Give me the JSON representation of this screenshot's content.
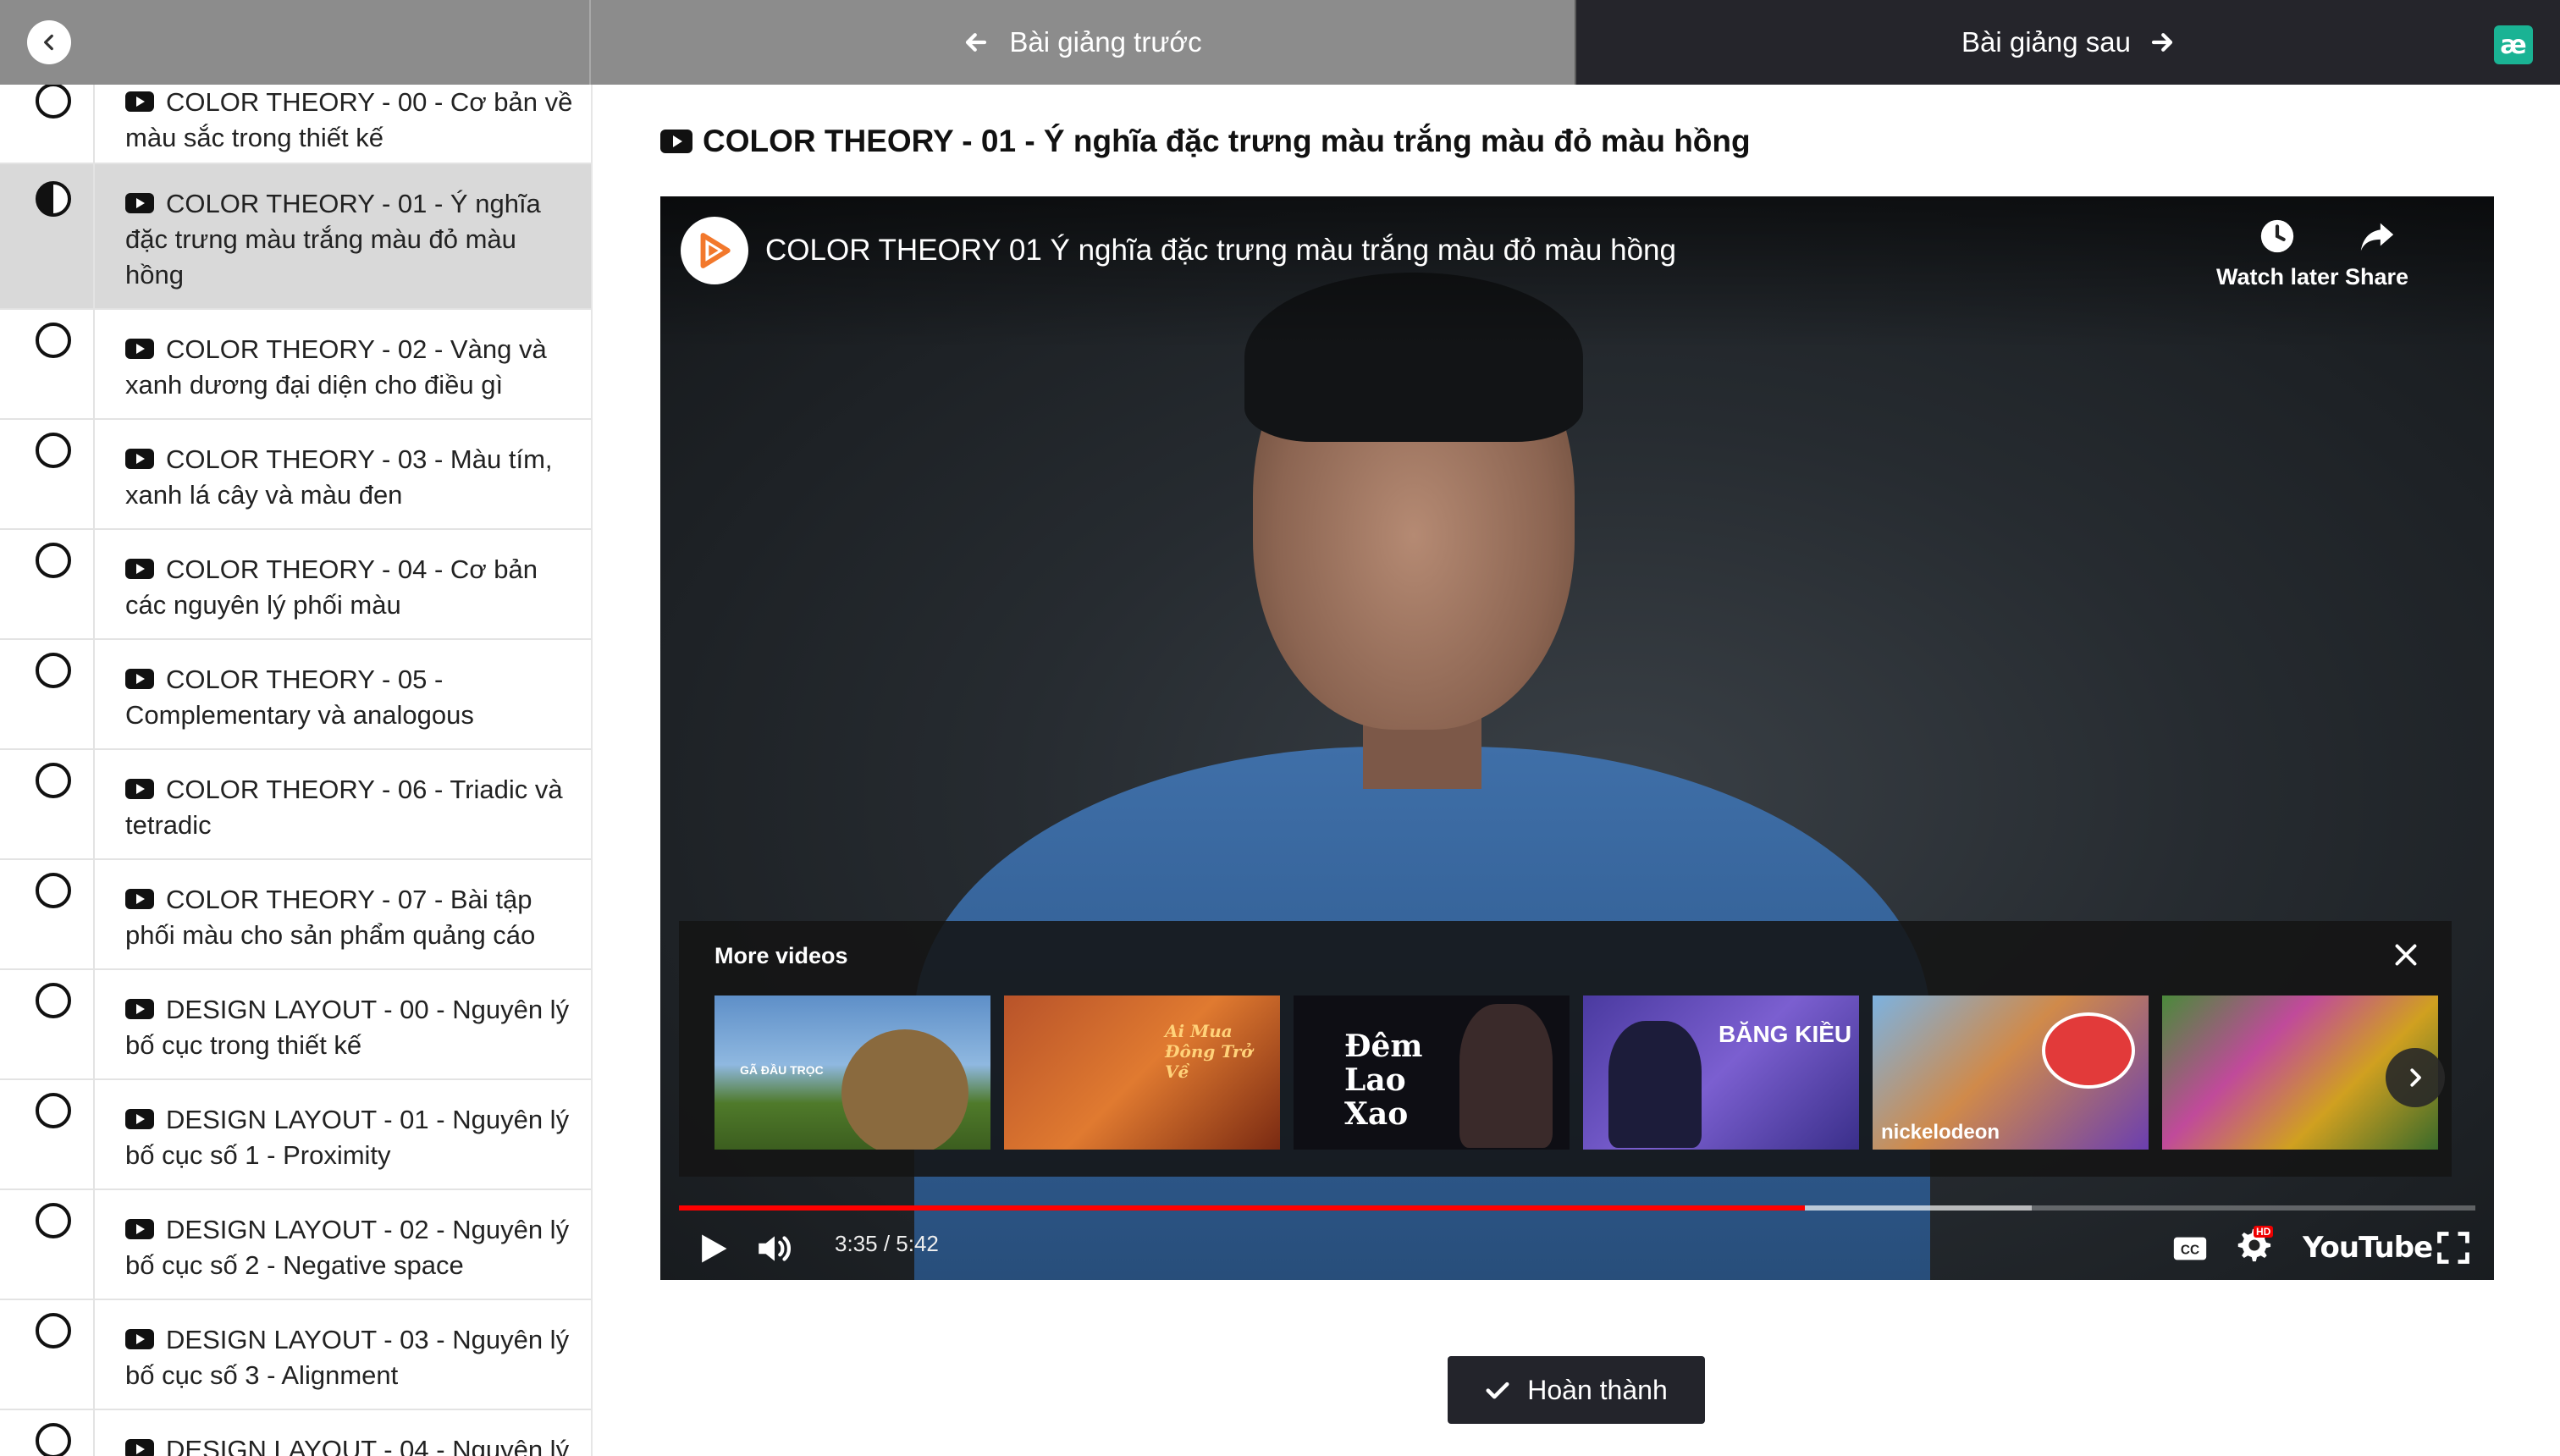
{
  "nav": {
    "prev_label": "Bài giảng trước",
    "next_label": "Bài giảng sau",
    "brand_glyph": "æ"
  },
  "sidebar": {
    "lessons": [
      {
        "title": "COLOR THEORY - 00 - Cơ bản về màu sắc trong thiết kế",
        "status": "not-started"
      },
      {
        "title": "COLOR THEORY - 01 - Ý nghĩa đặc trưng màu trắng màu đỏ màu hồng",
        "status": "in-progress"
      },
      {
        "title": "COLOR THEORY - 02 - Vàng và xanh dương đại diện cho điều gì",
        "status": "not-started"
      },
      {
        "title": "COLOR THEORY - 03 - Màu tím, xanh lá cây và màu đen",
        "status": "not-started"
      },
      {
        "title": "COLOR THEORY - 04 - Cơ bản các nguyên lý phối màu",
        "status": "not-started"
      },
      {
        "title": "COLOR THEORY - 05 - Complementary và analogous",
        "status": "not-started"
      },
      {
        "title": "COLOR THEORY - 06 - Triadic và tetradic",
        "status": "not-started"
      },
      {
        "title": "COLOR THEORY - 07 - Bài tập phối màu cho sản phẩm quảng cáo",
        "status": "not-started"
      },
      {
        "title": "DESIGN LAYOUT - 00 - Nguyên lý bố cục trong thiết kế",
        "status": "not-started"
      },
      {
        "title": "DESIGN LAYOUT - 01 - Nguyên lý bố cục số 1 - Proximity",
        "status": "not-started"
      },
      {
        "title": "DESIGN LAYOUT - 02 - Nguyên lý bố cục số 2 - Negative space",
        "status": "not-started"
      },
      {
        "title": "DESIGN LAYOUT - 03 - Nguyên lý bố cục số 3 - Alignment",
        "status": "not-started"
      },
      {
        "title": "DESIGN LAYOUT - 04 - Nguyên lý",
        "status": "not-started"
      }
    ]
  },
  "main": {
    "lesson_title": "COLOR THEORY - 01 - Ý nghĩa đặc trưng màu trắng màu đỏ màu hồng",
    "complete_label": "Hoàn thành"
  },
  "player": {
    "video_title": "COLOR THEORY 01 Ý nghĩa đặc trưng màu trắng màu đỏ màu hồng",
    "watch_later_label": "Watch later",
    "share_label": "Share",
    "more_videos_label": "More videos",
    "time_display": "3:35 / 5:42",
    "played_fraction": 0.627,
    "loaded_fraction": 0.753,
    "youtube_label": "YouTube",
    "hd_badge": "HD",
    "thumbnails": [
      {
        "label": "GÃ ĐẦU TRỌC",
        "bg": "#5e8fc8"
      },
      {
        "label": "Ai Mua Đông Trở Về",
        "bg": "#b8532a"
      },
      {
        "label": "Đêm Lao Xao",
        "bg": "#0e0e14"
      },
      {
        "label": "BĂNG KIỀU",
        "bg": "#6b4fc0"
      },
      {
        "label": "nickelodeon",
        "bg": "#7cb2e0"
      },
      {
        "label": "",
        "bg": "#4a8a3a"
      }
    ]
  },
  "colors": {
    "accent_red": "#ff0000",
    "topbar_gray": "#8c8c8c",
    "topbar_dark": "#25252b",
    "brand_green": "#1ab394"
  }
}
